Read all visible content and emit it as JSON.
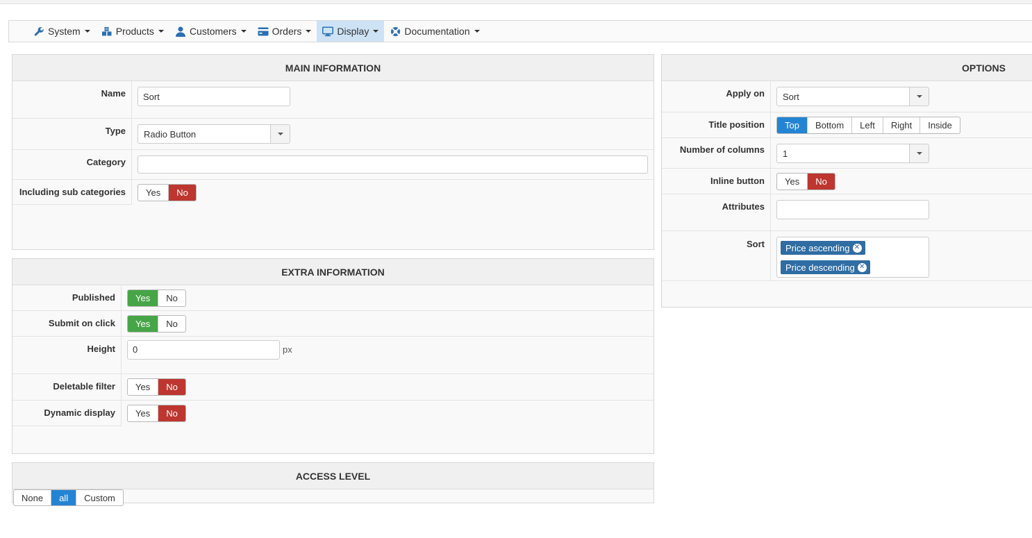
{
  "nav": [
    {
      "label": "System",
      "icon": "wrench-icon"
    },
    {
      "label": "Products",
      "icon": "cubes-icon"
    },
    {
      "label": "Customers",
      "icon": "user-icon"
    },
    {
      "label": "Orders",
      "icon": "credit-card-icon"
    },
    {
      "label": "Display",
      "icon": "monitor-icon",
      "active": true
    },
    {
      "label": "Documentation",
      "icon": "lifebuoy-icon"
    }
  ],
  "main_info": {
    "title": "MAIN INFORMATION",
    "name_label": "Name",
    "name_value": "Sort",
    "type_label": "Type",
    "type_value": "Radio Button",
    "category_label": "Category",
    "category_value": "",
    "subcat_label": "Including sub categories",
    "subcat_yes": "Yes",
    "subcat_no": "No"
  },
  "extra_info": {
    "title": "EXTRA INFORMATION",
    "published_label": "Published",
    "published_yes": "Yes",
    "published_no": "No",
    "submit_label": "Submit on click",
    "submit_yes": "Yes",
    "submit_no": "No",
    "height_label": "Height",
    "height_value": "0",
    "height_unit": "px",
    "deletable_label": "Deletable filter",
    "deletable_yes": "Yes",
    "deletable_no": "No",
    "dynamic_label": "Dynamic display",
    "dynamic_yes": "Yes",
    "dynamic_no": "No"
  },
  "access": {
    "title": "ACCESS LEVEL",
    "none": "None",
    "all": "all",
    "custom": "Custom"
  },
  "options": {
    "title": "OPTIONS",
    "apply_label": "Apply on",
    "apply_value": "Sort",
    "title_pos_label": "Title position",
    "pos_top": "Top",
    "pos_bottom": "Bottom",
    "pos_left": "Left",
    "pos_right": "Right",
    "pos_inside": "Inside",
    "columns_label": "Number of columns",
    "columns_value": "1",
    "inline_label": "Inline button",
    "inline_yes": "Yes",
    "inline_no": "No",
    "attributes_label": "Attributes",
    "attributes_value": "",
    "sort_label": "Sort",
    "sort_tags": [
      "Price ascending",
      "Price descending"
    ]
  },
  "colors": {
    "danger": "#bd362f",
    "success": "#46a546",
    "primary": "#2384d3",
    "tag": "#2f6da3",
    "nav_active": "#cde3f5"
  }
}
